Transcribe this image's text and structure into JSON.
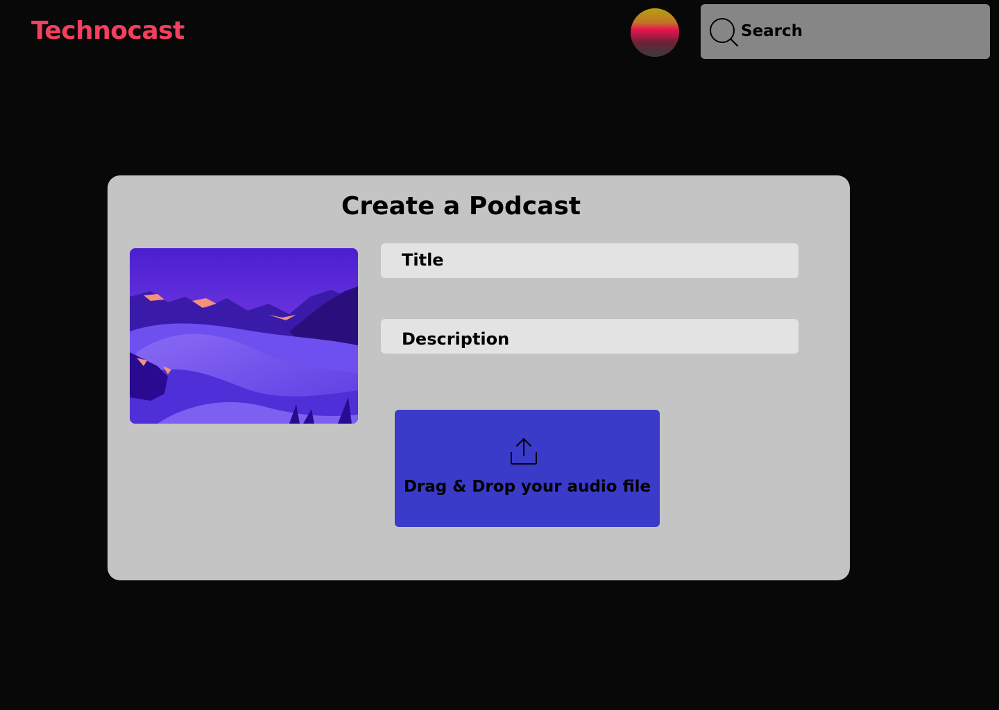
{
  "app": {
    "brand": "Technocast",
    "brand_color": "#f43f5e"
  },
  "header": {
    "search": {
      "placeholder": "Search",
      "icon": "search-icon"
    },
    "avatar": {
      "icon": "avatar"
    }
  },
  "form": {
    "title": "Create a Podcast",
    "cover_image": "cover-image",
    "title_field": {
      "placeholder": "Title"
    },
    "description_field": {
      "placeholder": "Description"
    },
    "upload": {
      "label": "Drag & Drop your audio file",
      "icon": "upload-icon",
      "color": "#3b3bc9"
    }
  }
}
